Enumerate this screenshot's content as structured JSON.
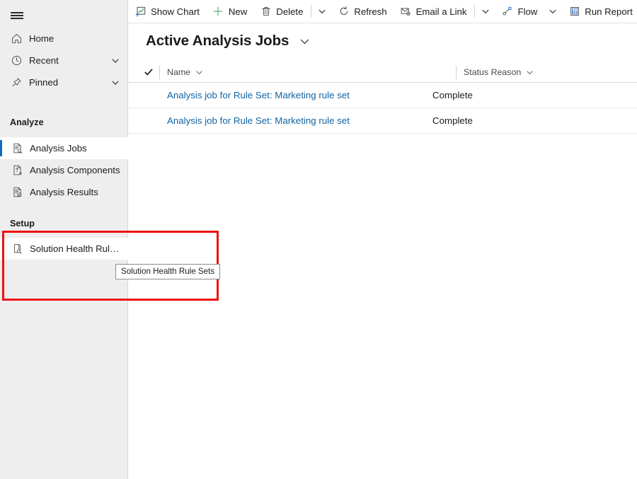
{
  "sidebar": {
    "hamburger_label": "Site map",
    "nav": [
      {
        "label": "Home",
        "icon": "home-icon",
        "chevron": false
      },
      {
        "label": "Recent",
        "icon": "clock-icon",
        "chevron": true
      },
      {
        "label": "Pinned",
        "icon": "pin-icon",
        "chevron": true
      }
    ],
    "groups": [
      {
        "title": "Analyze",
        "items": [
          {
            "label": "Analysis Jobs",
            "icon": "document-search-icon",
            "selected": true
          },
          {
            "label": "Analysis Components",
            "icon": "document-question-icon",
            "selected": false
          },
          {
            "label": "Analysis Results",
            "icon": "document-check-icon",
            "selected": false
          }
        ]
      },
      {
        "title": "Setup",
        "items": [
          {
            "label": "Solution Health Rule ...",
            "icon": "page-search-icon",
            "selected": true
          }
        ]
      }
    ],
    "tooltip": "Solution Health Rule Sets",
    "accent_color": "#0f6cbd",
    "highlight_color": "#ef1111",
    "background_color": "#eeeeee"
  },
  "commandbar": {
    "items": [
      {
        "type": "command",
        "label": "Show Chart",
        "icon": "show-chart-icon"
      },
      {
        "type": "command",
        "label": "New",
        "icon": "plus-icon"
      },
      {
        "type": "command",
        "label": "Delete",
        "icon": "trash-icon"
      },
      {
        "type": "divider",
        "label": ""
      },
      {
        "type": "chevron",
        "label": "More commands for Delete"
      },
      {
        "type": "command",
        "label": "Refresh",
        "icon": "refresh-icon"
      },
      {
        "type": "command",
        "label": "Email a Link",
        "icon": "email-link-icon"
      },
      {
        "type": "divider",
        "label": ""
      },
      {
        "type": "chevron",
        "label": "More commands for Email a Link"
      },
      {
        "type": "command",
        "label": "Flow",
        "icon": "flow-icon"
      },
      {
        "type": "chevron",
        "label": "More commands for Flow"
      },
      {
        "type": "command",
        "label": "Run Report",
        "icon": "run-report-icon"
      },
      {
        "type": "chevron",
        "label": "More commands for Run Report"
      }
    ]
  },
  "view": {
    "title": "Active Analysis Jobs",
    "selector_icon": "chevron-down-icon"
  },
  "grid": {
    "select_all_icon": "checkmark-icon",
    "columns": [
      {
        "key": "name",
        "label": "Name"
      },
      {
        "key": "status",
        "label": "Status Reason"
      }
    ],
    "rows": [
      {
        "name": "Analysis job for Rule Set: Marketing rule set",
        "status": "Complete"
      },
      {
        "name": "Analysis job for Rule Set: Marketing rule set",
        "status": "Complete"
      }
    ],
    "link_color": "#1264a3"
  }
}
